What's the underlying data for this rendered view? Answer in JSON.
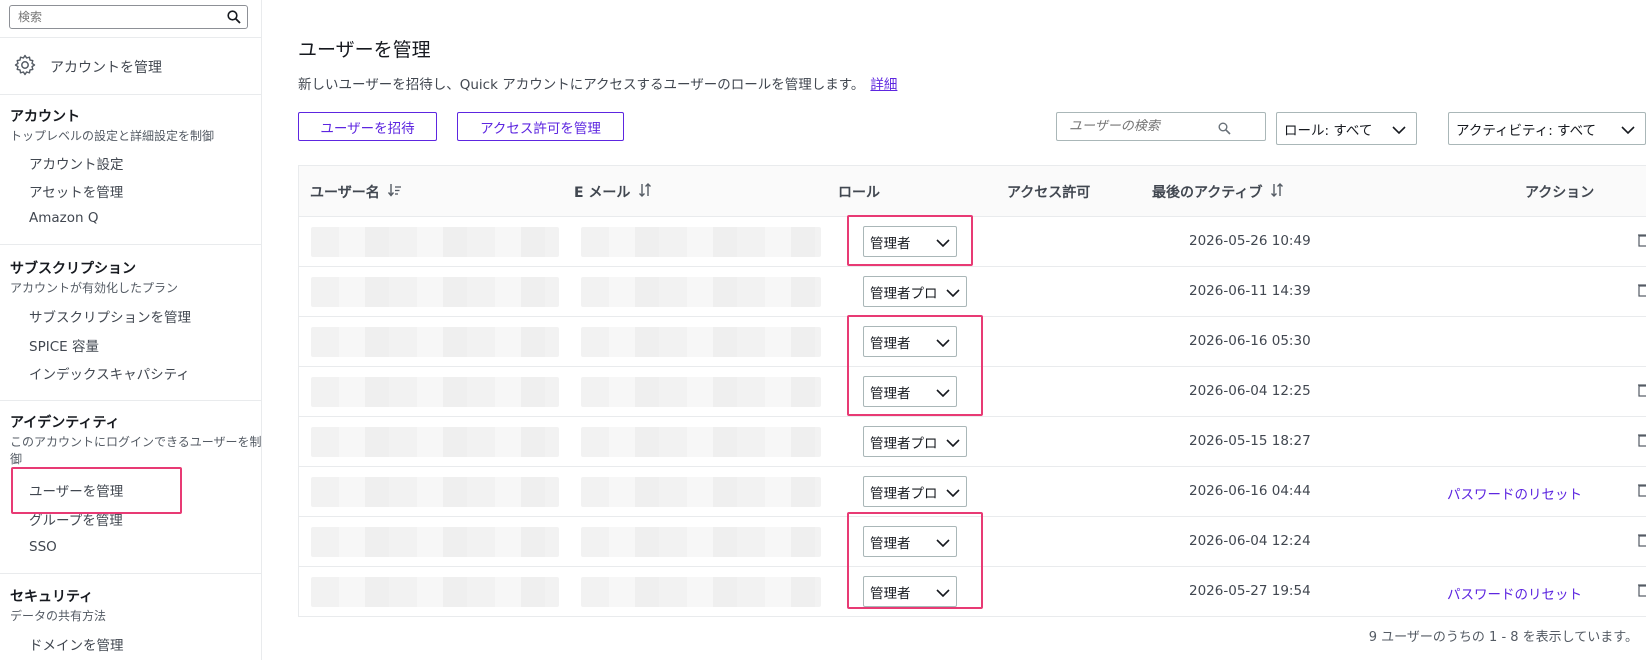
{
  "sidebar": {
    "search_placeholder": "検索",
    "manage_account": "アカウントを管理",
    "sections": [
      {
        "title": "アカウント",
        "subtitle": "トップレベルの設定と詳細設定を制御",
        "items": [
          "アカウント設定",
          "アセットを管理",
          "Amazon Q"
        ]
      },
      {
        "title": "サブスクリプション",
        "subtitle": "アカウントが有効化したプラン",
        "items": [
          "サブスクリプションを管理",
          "SPICE 容量",
          "インデックスキャパシティ"
        ]
      },
      {
        "title": "アイデンティティ",
        "subtitle": "このアカウントにログインできるユーザーを制御",
        "items": [
          "ユーザーを管理",
          "グループを管理",
          "SSO"
        ]
      },
      {
        "title": "セキュリティ",
        "subtitle": "データの共有方法",
        "items": [
          "ドメインを管理"
        ]
      }
    ]
  },
  "main": {
    "title": "ユーザーを管理",
    "description": "新しいユーザーを招待し、Quick アカウントにアクセスするユーザーのロールを管理します。",
    "details_link": "詳細",
    "invite_button": "ユーザーを招待",
    "permissions_button": "アクセス許可を管理",
    "search_placeholder": "ユーザーの検索",
    "role_filter": "ロール: すべて",
    "activity_filter": "アクティビティ: すべて",
    "columns": [
      "ユーザー名",
      "E メール",
      "ロール",
      "アクセス許可",
      "最後のアクティブ",
      "アクション"
    ],
    "rows": [
      {
        "role": "管理者",
        "last_active": "2026-05-26 10:49",
        "action": "",
        "trash": true
      },
      {
        "role": "管理者プロ",
        "last_active": "2026-06-11 14:39",
        "action": "",
        "trash": true
      },
      {
        "role": "管理者",
        "last_active": "2026-06-16 05:30",
        "action": "",
        "trash": false
      },
      {
        "role": "管理者",
        "last_active": "2026-06-04 12:25",
        "action": "",
        "trash": true
      },
      {
        "role": "管理者プロ",
        "last_active": "2026-05-15 18:27",
        "action": "",
        "trash": true
      },
      {
        "role": "管理者プロ",
        "last_active": "2026-06-16 04:44",
        "action": "パスワードのリセット",
        "trash": true
      },
      {
        "role": "管理者",
        "last_active": "2026-06-04 12:24",
        "action": "",
        "trash": true
      },
      {
        "role": "管理者",
        "last_active": "2026-05-27 19:54",
        "action": "パスワードのリセット",
        "trash": true
      }
    ],
    "footer": "9 ユーザーのうちの 1 - 8 を表示しています。"
  }
}
